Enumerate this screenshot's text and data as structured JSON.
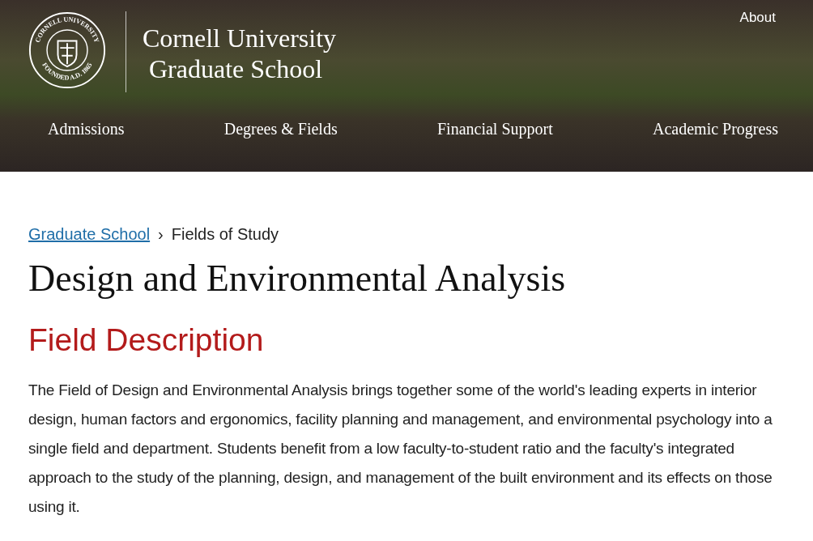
{
  "header": {
    "seal_top": "CORNELL UNIVERSITY",
    "seal_bottom": "FOUNDED A.D. 1865",
    "title_line_1": "Cornell University",
    "title_line_2": "Graduate School",
    "utility_link": "About",
    "nav": [
      {
        "label": "Admissions"
      },
      {
        "label": "Degrees & Fields"
      },
      {
        "label": "Financial Support"
      },
      {
        "label": "Academic Progress"
      }
    ]
  },
  "breadcrumb": [
    {
      "label": "Graduate School",
      "kind": "link"
    },
    {
      "label": "Fields of Study",
      "kind": "current"
    }
  ],
  "breadcrumb_separator": "›",
  "page_title": "Design and Environmental Analysis",
  "section_heading": "Field Description",
  "paragraph": "The Field of Design and Environmental Analysis brings together some of the world's leading experts in interior design, human factors and ergonomics, facility planning and management, and environmental psychology into a single field and department. Students benefit from a low faculty-to-student ratio and the faculty's integrated approach to the study of the planning, design, and management of the built environment and its effects on those using it."
}
